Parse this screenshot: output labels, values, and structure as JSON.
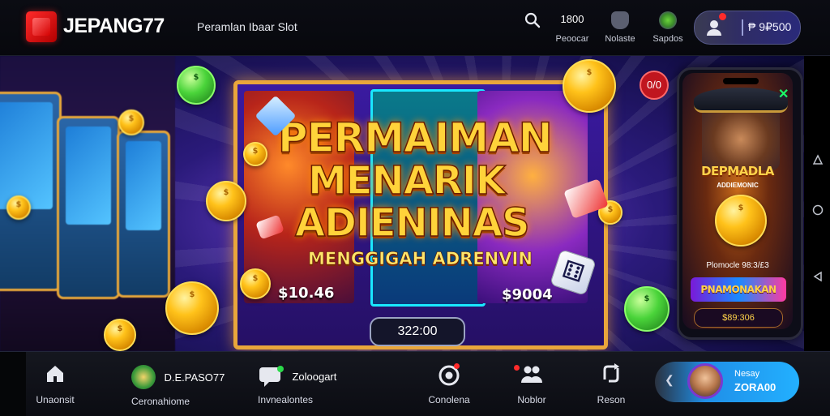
{
  "header": {
    "brand": "JEPANG77",
    "tagline": "Peramlan Ibaar Slot",
    "search_icon": "search-icon",
    "stat_value": "1800",
    "stat_label": "Peoocar",
    "notes_label": "Nolaste",
    "sports_label": "Sapdos",
    "account": {
      "balance": "₱ 9₽500"
    }
  },
  "hero": {
    "title_lines": [
      "PERMAIMAN",
      "MENARIK",
      "ADIENINAS"
    ],
    "subtitle": "MENGGIGAH ADRENVIN",
    "reel_left_value": "$10.46",
    "reel_right_value": "$9004",
    "timer": "322:00",
    "close_label": "0/0",
    "phone": {
      "title": "DEPMADLA",
      "subtitle": "ADDIEMONIC",
      "promo": "Plomocle 98:3/£3",
      "logo": "PNAMONAKAN",
      "amount": "$89:306"
    }
  },
  "bottom_nav": {
    "items": [
      {
        "label": "Unaonsit",
        "icon": "home-icon"
      },
      {
        "title": "D.E.PASO77",
        "label": "Ceronahiome",
        "icon": "slot-icon"
      },
      {
        "title": "Zoloogart",
        "label": "Invnealontes",
        "icon": "chat-icon"
      },
      {
        "label": "Conolena",
        "icon": "target-icon"
      },
      {
        "label": "Noblor",
        "icon": "users-icon"
      },
      {
        "label": "Reson",
        "icon": "refresh-icon"
      }
    ],
    "profile": {
      "name": "Nesay",
      "value": "ZORA00"
    }
  },
  "colors": {
    "brand_red": "#e01f1f",
    "title_gold": "#ffd33a",
    "accent_blue": "#23b0ff"
  }
}
